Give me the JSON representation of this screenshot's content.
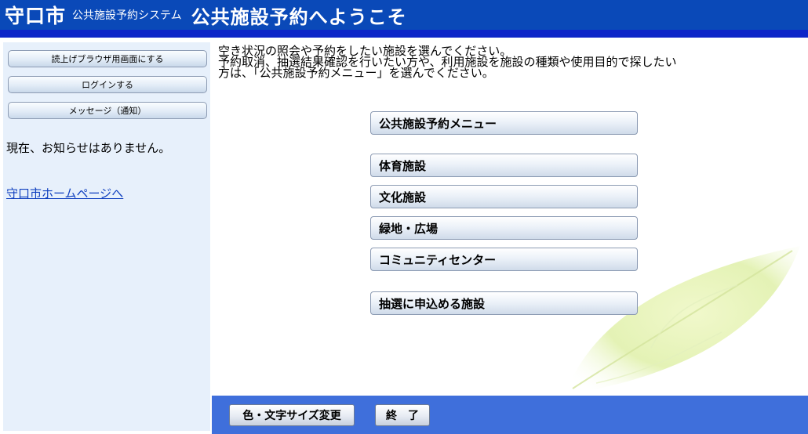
{
  "header": {
    "city": "守口市",
    "system": "公共施設予約システム",
    "welcome": "公共施設予約へようこそ"
  },
  "colors": {
    "header_bg": "#0a49b8",
    "header_line": "#0d26c8",
    "sidebar_bg": "#e7f0fb",
    "footer_bg": "#3f6fdb",
    "link": "#0f3fbf"
  },
  "sidebar": {
    "buttons": [
      {
        "label": "読上げブラウザ用画面にする"
      },
      {
        "label": "ログインする"
      },
      {
        "label": "メッセージ（通知）"
      }
    ],
    "notice": "現在、お知らせはありません。",
    "home_link": "守口市ホームページへ"
  },
  "main": {
    "intro": [
      "空き状況の照会や予約をしたい施設を選んでください。",
      "予約取消、抽選結果確認を行いたい方や、利用施設を施設の種類や使用目的で探したい",
      "方は、「公共施設予約メニュー」を選んでください。"
    ],
    "menu": [
      {
        "label": "公共施設予約メニュー"
      },
      {
        "label": "体育施設"
      },
      {
        "label": "文化施設"
      },
      {
        "label": "緑地・広場"
      },
      {
        "label": "コミュニティセンター"
      },
      {
        "label": "抽選に申込める施設"
      }
    ]
  },
  "footer": {
    "color_size_button": "色・文字サイズ変更",
    "exit_button": "終　了"
  }
}
